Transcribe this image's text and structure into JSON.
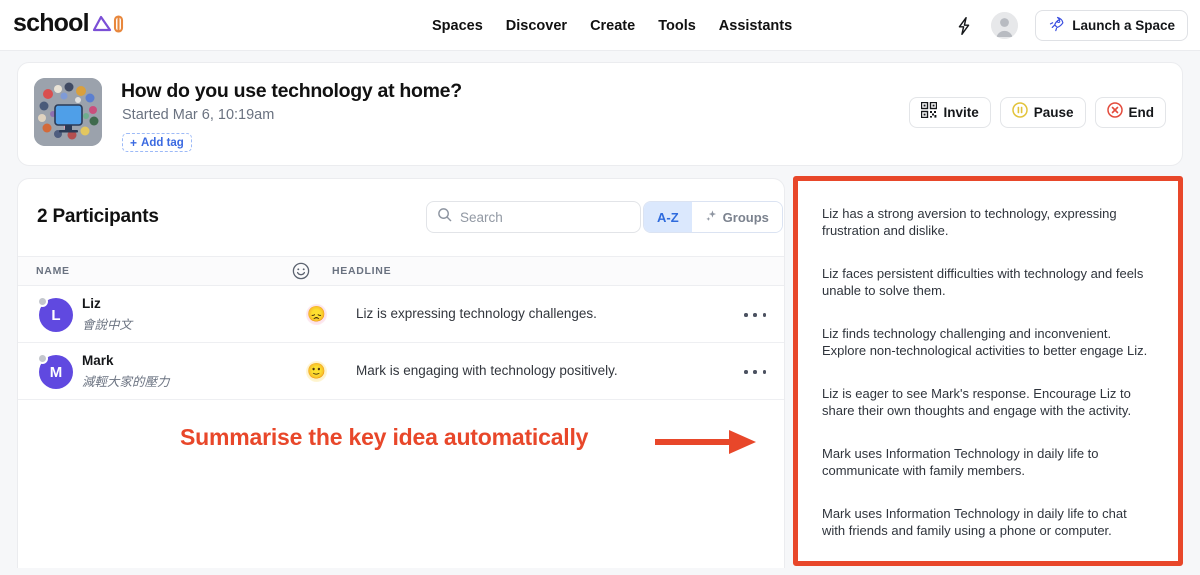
{
  "brand": {
    "name": "school",
    "mark_triangle_color": "#7b4fd6",
    "mark_bar_color": "#e8873c"
  },
  "nav": {
    "links": [
      {
        "label": "Spaces"
      },
      {
        "label": "Discover"
      },
      {
        "label": "Create"
      },
      {
        "label": "Tools"
      },
      {
        "label": "Assistants"
      }
    ],
    "bolt_icon": "lightning-bolt-icon",
    "avatar_icon": "user-avatar-icon",
    "launch_button": {
      "label": "Launch a Space",
      "icon": "rocket-icon",
      "icon_color": "#3b4fe0"
    }
  },
  "session": {
    "title": "How do you use technology at home?",
    "started": "Started Mar 6, 10:19am",
    "add_tag": {
      "label": "Add tag",
      "plus": "+"
    },
    "thumbnail_icon": "session-thumbnail-image",
    "actions": [
      {
        "label": "Invite",
        "icon": "qr-code-icon"
      },
      {
        "label": "Pause",
        "icon": "pause-circle-icon",
        "color": "#e2c33a"
      },
      {
        "label": "End",
        "icon": "end-circle-icon",
        "color": "#e34b3c"
      }
    ]
  },
  "participants_panel": {
    "count_label": "2 Participants",
    "search": {
      "placeholder": "Search",
      "value": "",
      "icon": "search-icon"
    },
    "segmented": [
      {
        "label": "A-Z",
        "active": true
      },
      {
        "label": "Groups",
        "active": false,
        "icon": "sparkle-icon"
      }
    ],
    "columns": {
      "name": "NAME",
      "emoji": "smiley-face-icon",
      "headline": "HEADLINE"
    },
    "rows": [
      {
        "initial": "L",
        "name": "Liz",
        "subtitle": "會說中文",
        "emoji": "😞",
        "emoji_name": "disappointed-face-emoji",
        "emoji_tone": "sad",
        "headline": "Liz is expressing technology challenges.",
        "more": "…"
      },
      {
        "initial": "M",
        "name": "Mark",
        "subtitle": "減輕大家的壓力",
        "emoji": "🙂",
        "emoji_name": "slightly-smiling-face-emoji",
        "emoji_tone": "neutral",
        "headline": "Mark is engaging with technology positively.",
        "more": "…"
      }
    ]
  },
  "annotation": {
    "text": "Summarise the key idea automatically",
    "color": "#e8472a",
    "arrow_icon": "right-arrow-icon"
  },
  "insights_panel": {
    "highlight_color": "#e8472a",
    "items": [
      "Liz has a strong aversion to technology, expressing frustration and dislike.",
      "Liz faces persistent difficulties with technology and feels unable to solve them.",
      "Liz finds technology challenging and inconvenient. Explore non-technological activities to better engage Liz.",
      "Liz is eager to see Mark's response. Encourage Liz to share their own thoughts and engage with the activity.",
      "Mark uses Information Technology in daily life to communicate with family members.",
      "Mark uses Information Technology in daily life to chat with friends and family using a phone or computer."
    ]
  }
}
